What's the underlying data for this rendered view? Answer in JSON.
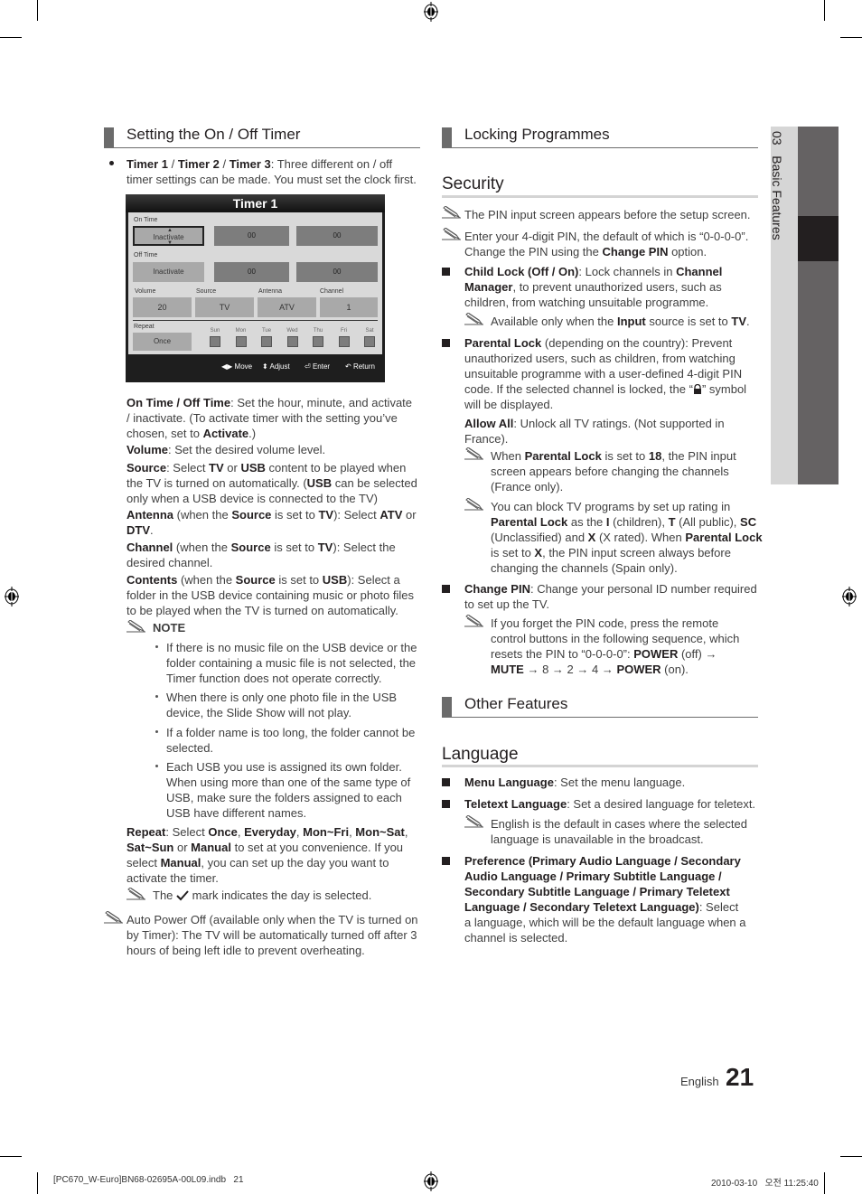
{
  "left": {
    "section_title": "Setting the On / Off Timer",
    "intro": {
      "b1": "Timer 1",
      "s1": " / ",
      "b2": "Timer 2",
      "s2": " / ",
      "b3": "Timer 3",
      "rest1": ": Three different on / off",
      "line2": "timer settings can be made. You must set the clock first."
    },
    "osd": {
      "title": "Timer 1",
      "on_time_label": "On Time",
      "on_time_state": "Inactivate",
      "on_hour": "00",
      "on_min": "00",
      "off_time_label": "Off Time",
      "off_time_state": "Inactivate",
      "off_hour": "00",
      "off_min": "00",
      "volume_label": "Volume",
      "volume_value": "20",
      "source_label": "Source",
      "source_value": "TV",
      "antenna_label": "Antenna",
      "antenna_value": "ATV",
      "channel_label": "Channel",
      "channel_value": "1",
      "repeat_label": "Repeat",
      "repeat_value": "Once",
      "days": [
        "Sun",
        "Mon",
        "Tue",
        "Wed",
        "Thu",
        "Fri",
        "Sat"
      ],
      "footer": {
        "move": "Move",
        "adjust": "Adjust",
        "enter": "Enter",
        "return": "Return"
      }
    },
    "desc": [
      [
        "On Time / Off Time",
        ": Set the hour, minute, and activate",
        "/ inactivate. (To activate timer with the setting you’ve",
        "chosen, set to ",
        "Activate",
        ".)"
      ],
      [
        "Volume",
        ": Set the desired volume level."
      ],
      [
        "Source",
        ": Select ",
        "TV",
        " or ",
        "USB",
        " content to be played when",
        "the TV is turned on automatically. (",
        "USB",
        " can be selected",
        "only when a USB device is connected to the TV)"
      ],
      [
        "Antenna",
        " (when the ",
        "Source",
        " is set to ",
        "TV",
        "): Select ",
        "ATV",
        " or",
        "DTV",
        "."
      ],
      [
        "Channel",
        " (when the ",
        "Source",
        " is set to ",
        "TV",
        "): Select the",
        "desired channel."
      ],
      [
        "Contents",
        " (when the ",
        "Source",
        " is set to ",
        "USB",
        "): Select a",
        "folder in the USB device containing music or photo files",
        "to be played when the TV is turned on automatically."
      ]
    ],
    "note_label": "NOTE",
    "notes": [
      [
        "If there is no music file on the USB device or the",
        "folder containing a music file is not selected, the",
        "Timer function does not operate correctly."
      ],
      [
        "When there is only one photo file in the USB",
        "device, the Slide Show will not play."
      ],
      [
        "If a folder name is too long, the folder cannot be",
        "selected."
      ],
      [
        "Each USB you use is assigned its own folder.",
        "When using more than one of the same type of",
        "USB, make sure the folders assigned to each",
        "USB have different names."
      ]
    ],
    "repeat": [
      "Repeat",
      ": Select ",
      "Once",
      ", ",
      "Everyday",
      ", ",
      "Mon~Fri",
      ", ",
      "Mon~Sat",
      ",",
      "Sat~Sun",
      " or ",
      "Manual",
      " to set at you convenience. If you",
      "select ",
      "Manual",
      ", you can set up the day you want to",
      "activate the timer."
    ],
    "check_note": [
      "The",
      "mark indicates the day is selected."
    ],
    "auto_power": [
      "Auto Power Off (available only when the TV is turned on",
      "by Timer): The TV will be automatically turned off after 3",
      "hours of being left idle to prevent overheating."
    ]
  },
  "right": {
    "section1_title": "Locking Programmes",
    "security_title": "Security",
    "sec_notes": [
      [
        "The PIN input screen appears before the setup screen."
      ],
      [
        "Enter your 4-digit PIN, the default of which is “0-0-0-0”.",
        "Change the PIN using the ",
        "Change PIN",
        " option."
      ]
    ],
    "child_lock": [
      "Child Lock (Off / On)",
      ": Lock channels in ",
      "Channel",
      "Manager",
      ", to prevent unauthorized users, such as",
      "children, from watching unsuitable programme."
    ],
    "child_note": [
      "Available only when the ",
      "Input",
      " source is set to ",
      "TV",
      "."
    ],
    "parental": [
      "Parental Lock",
      " (depending on the country): Prevent",
      "unauthorized users, such as children, from watching",
      "unsuitable programme with a user-defined 4-digit PIN",
      "code. If the selected channel is locked, the “",
      "” symbol",
      "will be displayed."
    ],
    "allow_all": [
      "Allow All",
      ": Unlock all TV ratings. (Not supported in",
      "France)."
    ],
    "par_note1": [
      "When ",
      "Parental Lock",
      " is set to ",
      "18",
      ", the PIN input",
      "screen appears before changing the channels",
      "(France only)."
    ],
    "par_note2": [
      "You can block TV programs by set up rating in",
      "Parental Lock",
      " as the ",
      "I",
      " (children), ",
      "T",
      " (All public), ",
      "SC",
      "(Unclassified) and ",
      "X",
      " (X rated). When ",
      "Parental Lock",
      "is set to ",
      "X",
      ", the PIN input screen always before",
      "changing the channels (Spain only)."
    ],
    "change_pin": [
      "Change PIN",
      ": Change your personal ID number required",
      "to set up the TV."
    ],
    "pin_note": [
      "If you forget the PIN code, press the remote",
      "control buttons in the following sequence, which",
      "resets the PIN to “0-0-0-0”: ",
      "POWER",
      " (off) →",
      "MUTE",
      " → 8 → 2 → 4 → ",
      "POWER",
      " (on)."
    ],
    "section2_title": "Other Features",
    "language_title": "Language",
    "menu_lang": [
      "Menu Language",
      ": Set the menu language."
    ],
    "teletext_lang": [
      "Teletext Language",
      ": Set a desired language for teletext."
    ],
    "teletext_note": [
      "English is the default in cases where the selected",
      "language is unavailable in the broadcast."
    ],
    "preference": [
      "Preference (Primary Audio Language / Secondary",
      "Audio Language / Primary Subtitle Language /",
      "Secondary Subtitle Language / Primary Teletext",
      "Language / Secondary Teletext Language)",
      ": Select",
      "a language, which will be the default language when a",
      "channel is selected."
    ]
  },
  "side_tab": "03   Basic Features",
  "footer": {
    "language": "English",
    "page_number": "21"
  },
  "slug": {
    "file": "[PC670_W-Euro]BN68-02695A-00L09.indb   21",
    "date": "2010-03-10   오전 11:25:40"
  }
}
